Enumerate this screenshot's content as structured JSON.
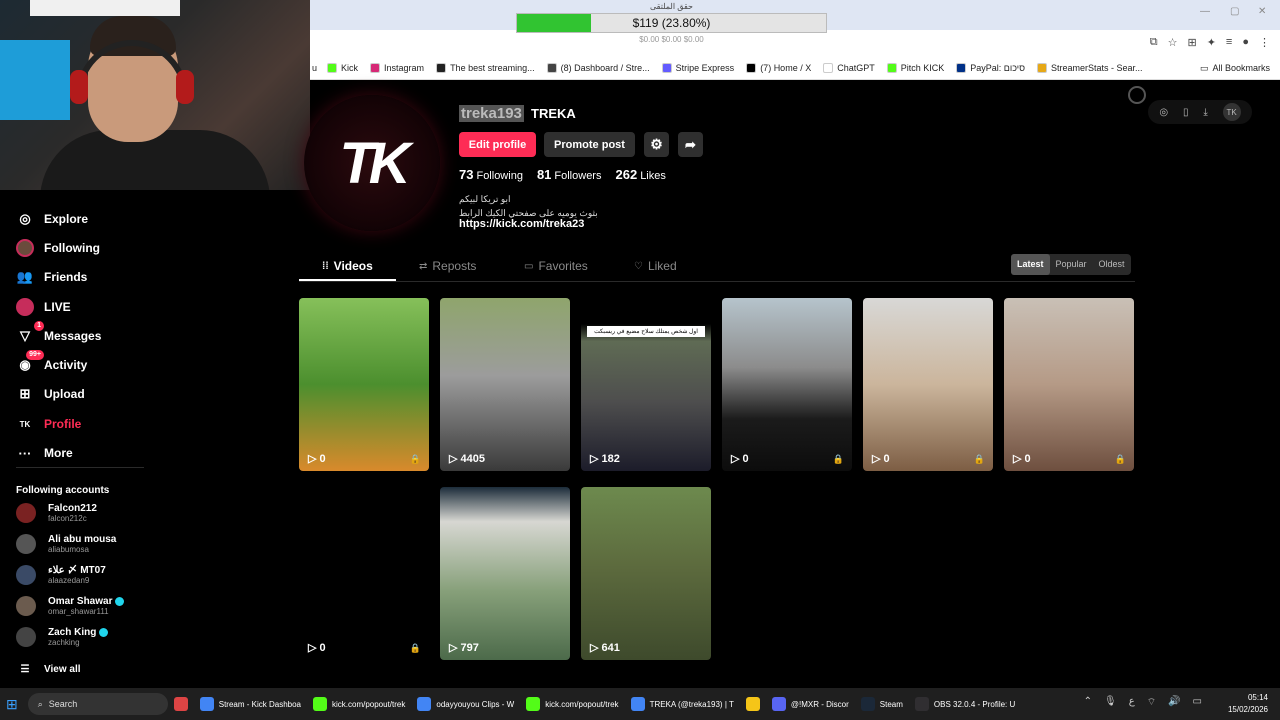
{
  "browser": {
    "progress": {
      "caption": "حقق الملتقى",
      "text": "$119 (23.80%)",
      "fraction": 0.238,
      "subtext": "$0.00 $0.00 $0.00"
    },
    "bookmarks": [
      {
        "label": "Kick",
        "color": "#53fc18"
      },
      {
        "label": "Instagram",
        "color": "#d62976"
      },
      {
        "label": "The best streaming...",
        "color": "#222222"
      },
      {
        "label": "(8) Dashboard / Stre...",
        "color": "#444444"
      },
      {
        "label": "Stripe Express",
        "color": "#635bff"
      },
      {
        "label": "(7) Home / X",
        "color": "#000000"
      },
      {
        "label": "ChatGPT",
        "color": "#ffffff"
      },
      {
        "label": "Pitch KICK",
        "color": "#53fc18"
      },
      {
        "label": "PayPal: סיכום",
        "color": "#003087"
      },
      {
        "label": "StreamerStats - Sear...",
        "color": "#e6a817"
      }
    ],
    "all_bookmarks": "All Bookmarks",
    "bookmark_partial": "u"
  },
  "sidebar": {
    "items": [
      {
        "label": "Explore",
        "icon": "compass-icon",
        "glyph": "◎"
      },
      {
        "label": "Following",
        "icon": "following-avatar-icon",
        "glyph": ""
      },
      {
        "label": "Friends",
        "icon": "friends-icon",
        "glyph": "👥"
      },
      {
        "label": "LIVE",
        "icon": "live-icon",
        "glyph": ""
      },
      {
        "label": "Messages",
        "icon": "messages-icon",
        "glyph": "▽",
        "badge": "1"
      },
      {
        "label": "Activity",
        "icon": "activity-icon",
        "glyph": "◉",
        "badge": "99+"
      },
      {
        "label": "Upload",
        "icon": "upload-icon",
        "glyph": "⊞"
      },
      {
        "label": "Profile",
        "icon": "profile-icon",
        "glyph": "TK"
      },
      {
        "label": "More",
        "icon": "more-icon",
        "glyph": "···"
      }
    ],
    "following_title": "Following accounts",
    "accounts": [
      {
        "name": "Falcon212",
        "user": "falcon212c",
        "verified": false
      },
      {
        "name": "Ali abu mousa",
        "user": "aliabumosa",
        "verified": false
      },
      {
        "name": "علاء 〆 MT07",
        "user": "alaazedan9",
        "verified": false
      },
      {
        "name": "Omar Shawar",
        "user": "omar_shawar111",
        "verified": true
      },
      {
        "name": "Zach King",
        "user": "zachking",
        "verified": true
      }
    ],
    "view_all": "View all"
  },
  "profile": {
    "avatar_text": "TK",
    "username": "treka193",
    "display_name": "TREKA",
    "edit_button": "Edit profile",
    "promote_button": "Promote post",
    "following_count": "73",
    "following_label": "Following",
    "followers_count": "81",
    "followers_label": "Followers",
    "likes_count": "262",
    "likes_label": "Likes",
    "bio_line1": "ابو تريكا لبيكم",
    "bio_line2": "بثوث يوميه على صفحتي الكيك الرابط",
    "link": "https://kick.com/treka23"
  },
  "tabs": [
    {
      "label": "Videos",
      "icon": "grid-icon",
      "glyph": "⁞⁞"
    },
    {
      "label": "Reposts",
      "icon": "repost-icon",
      "glyph": "⇄"
    },
    {
      "label": "Favorites",
      "icon": "bookmark-icon",
      "glyph": "▭"
    },
    {
      "label": "Liked",
      "icon": "heart-icon",
      "glyph": "♡"
    }
  ],
  "sort": {
    "latest": "Latest",
    "popular": "Popular",
    "oldest": "Oldest",
    "selected": "Latest"
  },
  "videos": [
    {
      "views": "0",
      "locked": true,
      "bg": "linear-gradient(180deg,#86c05a 0%,#4c8f2e 50%,#d98a2c 100%)"
    },
    {
      "views": "4405",
      "locked": false,
      "bg": "linear-gradient(180deg,#8fa56c 0%,#9c9c9c 45%,#3a3a3a 100%)"
    },
    {
      "views": "182",
      "locked": false,
      "bg": "linear-gradient(180deg,#000 0%,#000 15%,#5f6b54 25%,#4e4e4e 60%,#1c1c2a 100%)",
      "caption": "اول شخص يمتلك سلاح مضيع في ريسبكت"
    },
    {
      "views": "0",
      "locked": true,
      "bg": "linear-gradient(180deg,#b6c4cc 0%,#8c8c8c 40%,#1b1b1b 70%,#0c0c0c 100%)"
    },
    {
      "views": "0",
      "locked": true,
      "bg": "linear-gradient(180deg,#d8d8d6 0%,#cbb59c 50%,#7d5e44 100%)"
    },
    {
      "views": "0",
      "locked": true,
      "bg": "linear-gradient(180deg,#c9c0b6 0%,#b59a86 50%,#6e4f3f 100%)"
    },
    {
      "views": "0",
      "locked": true,
      "bg": "#000"
    },
    {
      "views": "797",
      "locked": false,
      "bg": "linear-gradient(180deg,#1c2c3a 0%,#d7d7d2 20%,#87a07a 60%,#4c6a4a 100%)"
    },
    {
      "views": "641",
      "locked": false,
      "bg": "linear-gradient(180deg,#6d8a4e 0%,#5d6b3e 45%,#3e4a2c 100%)"
    }
  ],
  "taskbar": {
    "search": "Search",
    "items": [
      {
        "label": "Stream - Kick Dashboa",
        "color": "#4285f4"
      },
      {
        "label": "kick.com/popout/trek",
        "color": "#53fc18"
      },
      {
        "label": "odayyouyou Clips - W",
        "color": "#4285f4"
      },
      {
        "label": "kick.com/popout/trek",
        "color": "#53fc18"
      },
      {
        "label": "TREKA (@treka193) | T",
        "color": "#4285f4"
      },
      {
        "label": "",
        "color": "#f5c518"
      },
      {
        "label": "@!MXR - Discor",
        "color": "#5865f2"
      },
      {
        "label": "Steam",
        "color": "#1b2838"
      },
      {
        "label": "OBS 32.0.4 - Profile: U",
        "color": "#302e31"
      }
    ],
    "time": "05:14",
    "date": "15/02/2026",
    "lang": "ع"
  }
}
